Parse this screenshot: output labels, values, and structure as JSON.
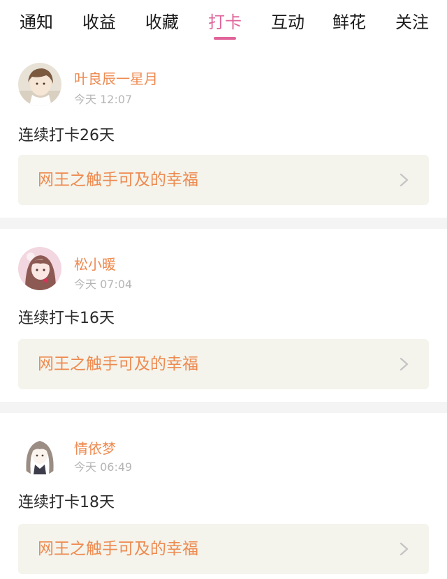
{
  "tabs": [
    {
      "label": "通知",
      "active": false
    },
    {
      "label": "收益",
      "active": false
    },
    {
      "label": "收藏",
      "active": false
    },
    {
      "label": "打卡",
      "active": true
    },
    {
      "label": "互动",
      "active": false
    },
    {
      "label": "鲜花",
      "active": false
    },
    {
      "label": "关注",
      "active": false
    }
  ],
  "colors": {
    "active_tab": "#e0649a",
    "username": "#ee8a50",
    "book_title": "#ee8a50",
    "book_bg": "#f4f4ec",
    "timestamp": "#b5b5b5",
    "divider": "#f4f4f4"
  },
  "checkins": [
    {
      "username": "叶良辰一星月",
      "time": "今天 12:07",
      "streak": "连续打卡26天",
      "book": "网王之触手可及的幸福",
      "avatar_icon": "avatar-boy-icon",
      "book_icon": "chevron-right-icon"
    },
    {
      "username": "松小暖",
      "time": "今天 07:04",
      "streak": "连续打卡16天",
      "book": "网王之触手可及的幸福",
      "avatar_icon": "avatar-girl-pink-icon",
      "book_icon": "chevron-right-icon"
    },
    {
      "username": "情依梦",
      "time": "今天 06:49",
      "streak": "连续打卡18天",
      "book": "网王之触手可及的幸福",
      "avatar_icon": "avatar-girl-sketch-icon",
      "book_icon": "chevron-right-icon"
    }
  ]
}
